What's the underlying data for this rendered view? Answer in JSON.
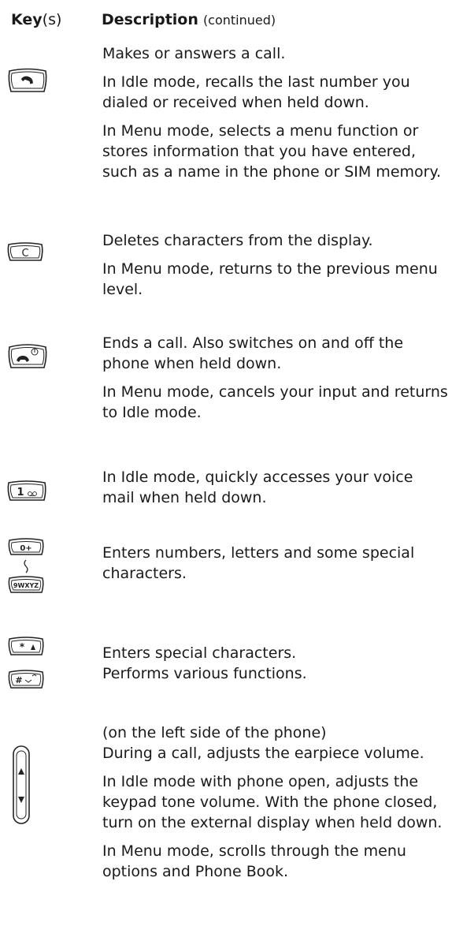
{
  "header": {
    "key_label": "Key",
    "key_suffix": "(s)",
    "desc_label": "Description",
    "desc_suffix": "(continued)"
  },
  "rows": [
    {
      "icon": "send-key-icon",
      "paragraphs": [
        "Makes or answers a call.",
        "In Idle mode, recalls the last number you dialed or received when held down.",
        "In Menu mode, selects a menu function or stores information that you have entered, such as a name in the phone or SIM memory."
      ]
    },
    {
      "icon": "clear-key-icon",
      "key_glyph": "C",
      "paragraphs": [
        "Deletes characters from the display.",
        "In Menu mode, returns to the previous menu level."
      ]
    },
    {
      "icon": "end-power-key-icon",
      "paragraphs": [
        "Ends a call. Also switches on and off the phone when held down.",
        "In Menu mode, cancels your input and returns to Idle mode."
      ]
    },
    {
      "icon": "voicemail-1-key-icon",
      "key_glyph": "1",
      "paragraphs": [
        "In Idle mode, quickly accesses your voice mail when held down."
      ]
    },
    {
      "icon": "number-keys-0-9-icon",
      "key_glyph_top": "0+",
      "key_glyph_bottom": "9WXYZ",
      "paragraphs": [
        "Enters numbers, letters and some special characters."
      ]
    },
    {
      "icon": "star-hash-keys-icon",
      "key_glyph_top": "*",
      "key_glyph_bottom": "#",
      "paragraphs": [
        "Enters special characters.",
        "Performs various functions."
      ]
    },
    {
      "icon": "volume-side-keys-icon",
      "paragraphs": [
        "(on the left side of the phone)",
        "During a call, adjusts the earpiece volume.",
        "In Idle mode with phone open, adjusts the keypad tone volume. With the phone closed, turn on the external display when held down.",
        "In Menu mode, scrolls through the menu options and Phone Book."
      ]
    }
  ]
}
